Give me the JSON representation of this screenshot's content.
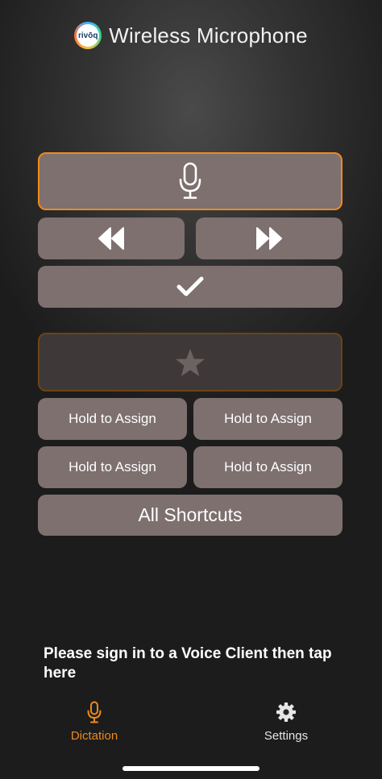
{
  "app": {
    "title": "Wireless Microphone",
    "logo_text": "rivōq"
  },
  "controls": {
    "mic_icon": "microphone-icon",
    "rewind_icon": "rewind-icon",
    "fast_forward_icon": "fast-forward-icon",
    "confirm_icon": "checkmark-icon",
    "favorite_icon": "star-icon"
  },
  "shortcuts": {
    "slots": [
      {
        "label": "Hold to Assign"
      },
      {
        "label": "Hold to Assign"
      },
      {
        "label": "Hold to Assign"
      },
      {
        "label": "Hold to Assign"
      }
    ],
    "all_label": "All Shortcuts"
  },
  "status": {
    "message": "Please sign in to a Voice Client then tap here"
  },
  "tabbar": {
    "items": [
      {
        "label": "Dictation",
        "icon": "microphone-icon",
        "active": true
      },
      {
        "label": "Settings",
        "icon": "gear-icon",
        "active": false
      }
    ]
  },
  "colors": {
    "accent": "#ef8a1c",
    "button": "#7d706f",
    "background": "#2a2a2a"
  }
}
